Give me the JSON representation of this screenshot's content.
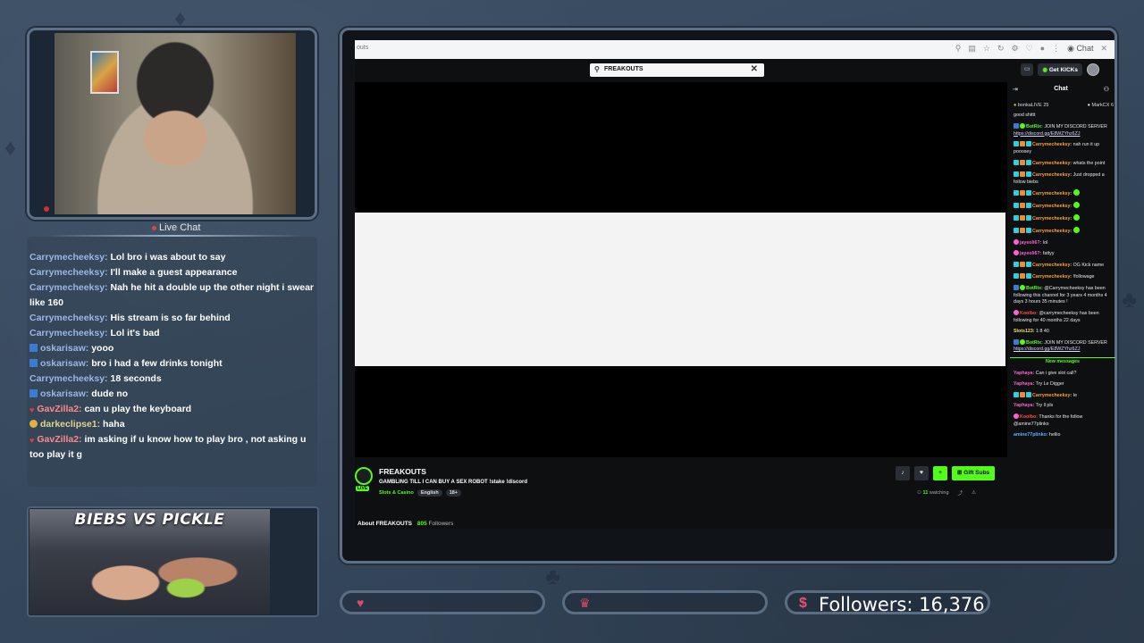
{
  "overlay": {
    "live_chat_title": "Live Chat",
    "promo_title": "BIEBS VS PICKLE",
    "followers_label": "Followers: 16,376",
    "accent_color": "#53fc18"
  },
  "live_chat": [
    {
      "user": "Carrymecheeksy:",
      "text": "Lol bro i was about to say",
      "badge": ""
    },
    {
      "user": "Carrymecheeksy:",
      "text": "I'll make a guest appearance",
      "badge": ""
    },
    {
      "user": "Carrymecheeksy:",
      "text": "Nah he hit a double up the other night i swear like 160",
      "badge": ""
    },
    {
      "user": "Carrymecheeksy:",
      "text": "His stream is so far behind",
      "badge": ""
    },
    {
      "user": "Carrymecheeksy:",
      "text": "Lol it's bad",
      "badge": ""
    },
    {
      "user": "oskarisaw:",
      "text": "yooo",
      "badge": "blue"
    },
    {
      "user": "oskarisaw:",
      "text": "bro i had a few drinks tonight",
      "badge": "blue"
    },
    {
      "user": "Carrymecheeksy:",
      "text": "18 seconds",
      "badge": ""
    },
    {
      "user": "oskarisaw:",
      "text": "dude no",
      "badge": "blue"
    },
    {
      "user": "GavZilla2:",
      "text": "can u play the keyboard",
      "badge": "heart"
    },
    {
      "user": "darkeclipse1:",
      "text": "haha",
      "badge": "coin"
    },
    {
      "user": "GavZilla2:",
      "text": "im asking if u know how to play bro , not asking u too play it g",
      "badge": "heart"
    }
  ],
  "browser": {
    "url_fragment": "outs",
    "chat_button": "Chat"
  },
  "kick": {
    "search_value": "FREAKOUTS",
    "get_kicks_label": "Get KICKs",
    "streamer_name": "FREAKOUTS",
    "stream_title": "GAMBLING TILL I CAN BUY A SEX ROBOT !stake !discord",
    "category": "Slots & Casino",
    "language_tag": "English",
    "age_tag": "18+",
    "live_label": "LIVE",
    "gift_subs_label": "Gift Subs",
    "watching_count": "11",
    "watching_label": "watching",
    "about_label": "About FREAKOUTS",
    "follower_count": "805",
    "followers_label": "Followers"
  },
  "kick_chat": {
    "title": "Chat",
    "pinned_left": "bonkaLIVE",
    "pinned_left_count": "25",
    "pinned_right": "MarkCX",
    "pinned_right_count": "6",
    "first_line": "good shittt",
    "messages": [
      {
        "user": "BotRix:",
        "text": "JOIN MY DISCORD SERVER",
        "link": "https://discord.gg/E8WZYhz6ZJ",
        "cls": "u-g",
        "badges": [
          "bl",
          "gr"
        ]
      },
      {
        "user": "Carrymecheeksy:",
        "text": "nah run it up pooosey",
        "cls": "u-o",
        "badges": [
          "cy",
          "or",
          "cy"
        ]
      },
      {
        "user": "Carrymecheeksy:",
        "text": "whats the point",
        "cls": "u-o",
        "badges": [
          "cy",
          "or",
          "cy"
        ]
      },
      {
        "user": "Carrymecheeksy:",
        "text": "Just dropped a follow biebs",
        "cls": "u-o",
        "badges": [
          "cy",
          "or",
          "cy"
        ]
      },
      {
        "user": "Carrymecheeksy:",
        "text": "",
        "emote": true,
        "cls": "u-o",
        "badges": [
          "cy",
          "or",
          "cy"
        ]
      },
      {
        "user": "Carrymecheeksy:",
        "text": "",
        "emote": true,
        "cls": "u-o",
        "badges": [
          "cy",
          "or",
          "cy"
        ]
      },
      {
        "user": "Carrymecheeksy:",
        "text": "",
        "emote": true,
        "cls": "u-o",
        "badges": [
          "cy",
          "or",
          "cy"
        ]
      },
      {
        "user": "Carrymecheeksy:",
        "text": "",
        "emote": true,
        "cls": "u-o",
        "badges": [
          "cy",
          "or",
          "cy"
        ]
      },
      {
        "user": "jayeoli6?:",
        "text": "lol",
        "cls": "u-p",
        "badges": [
          "pk"
        ]
      },
      {
        "user": "jayeoli6?:",
        "text": "fattyy",
        "cls": "u-p",
        "badges": [
          "pk"
        ]
      },
      {
        "user": "Carrymecheeksy:",
        "text": "OG Kick name",
        "cls": "u-o",
        "badges": [
          "cy",
          "or",
          "cy"
        ]
      },
      {
        "user": "Carrymecheeksy:",
        "text": "!followage",
        "cls": "u-o",
        "badges": [
          "cy",
          "or",
          "cy"
        ]
      },
      {
        "user": "BotRix:",
        "text": "@Carrymecheeksy has been following this channel for 3 years 4 months 4 days 3 hours 35 minutes !",
        "cls": "u-g",
        "badges": [
          "bl",
          "gr"
        ]
      },
      {
        "user": "Koolbo:",
        "text": "@carrymecheeksy has been following for 40 months 22 days",
        "cls": "u-r",
        "badges": [
          "pk"
        ]
      },
      {
        "user": "Slots123:",
        "text": "1:8 40",
        "cls": "u-y",
        "badges": []
      },
      {
        "user": "BotRix:",
        "text": "JOIN MY DISCORD SERVER",
        "link": "https://discord.gg/E8WZYhz6ZJ",
        "cls": "u-g",
        "badges": [
          "bl",
          "gr"
        ]
      }
    ],
    "new_messages_label": "New messages",
    "after_messages": [
      {
        "user": "Yaphaya:",
        "text": "Can i give slot call?",
        "cls": "u-p",
        "badges": []
      },
      {
        "user": "Yaphaya:",
        "text": "Try Le Digger",
        "cls": "u-p",
        "badges": []
      },
      {
        "user": "Carrymecheeksy:",
        "text": "Ie",
        "cls": "u-o",
        "badges": [
          "cy",
          "or",
          "cy"
        ]
      },
      {
        "user": "Yaphaya:",
        "text": "Try ll pls",
        "cls": "u-p",
        "badges": []
      },
      {
        "user": "Koolbo:",
        "text": "Thanks for the follow @amine77plinko",
        "cls": "u-r",
        "badges": [
          "pk"
        ]
      },
      {
        "user": "amine77plinko:",
        "text": "hellio",
        "cls": "u-b",
        "badges": []
      }
    ]
  }
}
